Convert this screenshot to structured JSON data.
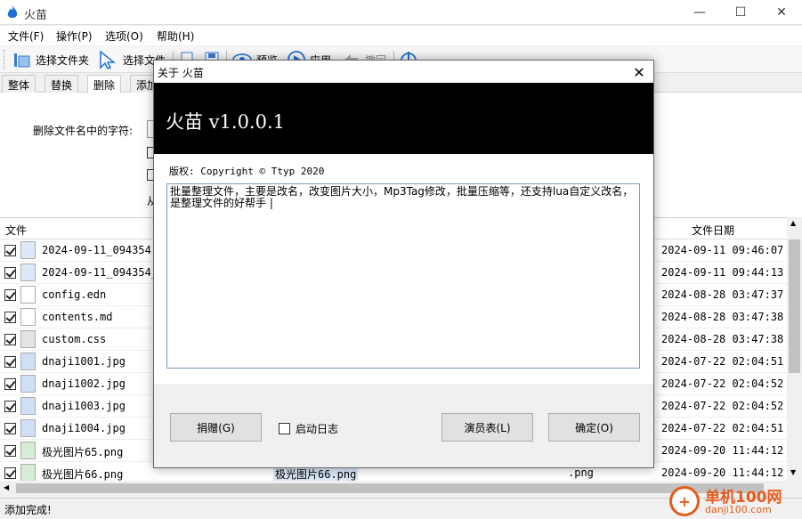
{
  "window": {
    "title": "火苗"
  },
  "menu": [
    "文件(F)",
    "操作(P)",
    "选项(O)",
    "帮助(H)"
  ],
  "toolbar": {
    "select_folder": "选择文件夹",
    "select_file": "选择文件",
    "preview": "预览",
    "apply": "应用",
    "undo": "撤回"
  },
  "tabs": [
    "整体",
    "替换",
    "删除",
    "添加"
  ],
  "delete_panel": {
    "label": "删除文件名中的字符:",
    "from_label": "从"
  },
  "file_list": {
    "col_file": "文件",
    "col_date": "文件日期",
    "rows": [
      {
        "name": "2024-09-11_094354.bmp",
        "date": "2024-09-11 09:46:07"
      },
      {
        "name": "2024-09-11_094354_bak",
        "date": "2024-09-11 09:44:13"
      },
      {
        "name": "config.edn",
        "date": "2024-08-28 03:47:37"
      },
      {
        "name": "contents.md",
        "date": "2024-08-28 03:47:38"
      },
      {
        "name": "custom.css",
        "date": "2024-08-28 03:47:38"
      },
      {
        "name": "dnaji1001.jpg",
        "date": "2024-07-22 02:04:51"
      },
      {
        "name": "dnaji1002.jpg",
        "date": "2024-07-22 02:04:52"
      },
      {
        "name": "dnaji1003.jpg",
        "date": "2024-07-22 02:04:52"
      },
      {
        "name": "dnaji1004.jpg",
        "date": "2024-07-22 02:04:51"
      },
      {
        "name": "极光图片65.png",
        "date": "2024-09-20 11:44:12"
      },
      {
        "name": "极光图片66.png",
        "new_name": "极光图片66.png",
        "ext": ".png",
        "date": "2024-09-20 11:44:12"
      }
    ]
  },
  "status": "添加完成!",
  "watermark": {
    "text": "单机100网",
    "sub": "danji100.com"
  },
  "about_dialog": {
    "title": "关于 火苗",
    "banner": "火苗 v1.0.0.1",
    "copyright": "版权: Copyright © Ttyp 2020",
    "description": "批量整理文件，主要是改名，改变图片大小，Mp3Tag修改，批量压缩等，还支持lua自定义改名，是整理文件的好帮手  |",
    "donate_button": "捐赠(G)",
    "log_checkbox": "启动日志",
    "credits_button": "演员表(L)",
    "ok_button": "确定(O)"
  }
}
